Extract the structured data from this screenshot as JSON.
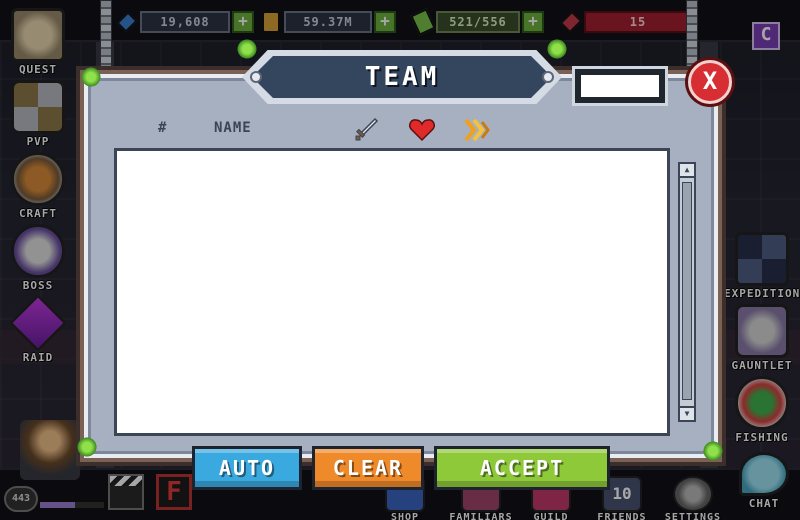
{
  "resources": {
    "gems": "19,608",
    "gold": "59.37M",
    "energy": "521/556",
    "tokens": "15",
    "plus_label": "+"
  },
  "guild_badge": "C",
  "left_menu": [
    {
      "label": "QUEST",
      "icon": "quest-scroll-icon"
    },
    {
      "label": "PVP",
      "icon": "crossed-swords-icon"
    },
    {
      "label": "CRAFT",
      "icon": "cauldron-icon"
    },
    {
      "label": "BOSS",
      "icon": "boss-skull-icon"
    },
    {
      "label": "RAID",
      "icon": "purple-crystal-icon"
    }
  ],
  "right_menu": [
    {
      "label": "EXPEDITION",
      "icon": "expedition-swords-icon"
    },
    {
      "label": "GAUNTLET",
      "icon": "gauntlet-mask-icon"
    },
    {
      "label": "FISHING",
      "icon": "fishing-bobber-icon"
    },
    {
      "label": "CHAT",
      "icon": "chat-bubble-icon"
    }
  ],
  "bottom_menu": [
    {
      "label": "SHOP"
    },
    {
      "label": "FAMILIARS"
    },
    {
      "label": "GUILD"
    },
    {
      "label": "FRIENDS",
      "count": "10"
    },
    {
      "label": "SETTINGS"
    }
  ],
  "player": {
    "level": "443",
    "xp_fraction": 0.55
  },
  "f_badge": "F",
  "modal": {
    "title": "TEAM",
    "close_label": "X",
    "search_value": "",
    "columns": {
      "number": "#",
      "name": "NAME",
      "attack_icon": "sword-icon",
      "health_icon": "heart-icon",
      "speed_icon": "speed-chevron-icon"
    },
    "rows": [],
    "buttons": {
      "auto": "AUTO",
      "clear": "CLEAR",
      "accept": "ACCEPT"
    }
  },
  "colors": {
    "auto_button": "#3aa9e0",
    "clear_button": "#ef8a2a",
    "accept_button": "#8ec93a",
    "close_button": "#d62e33",
    "title_plate": "#33465d"
  }
}
